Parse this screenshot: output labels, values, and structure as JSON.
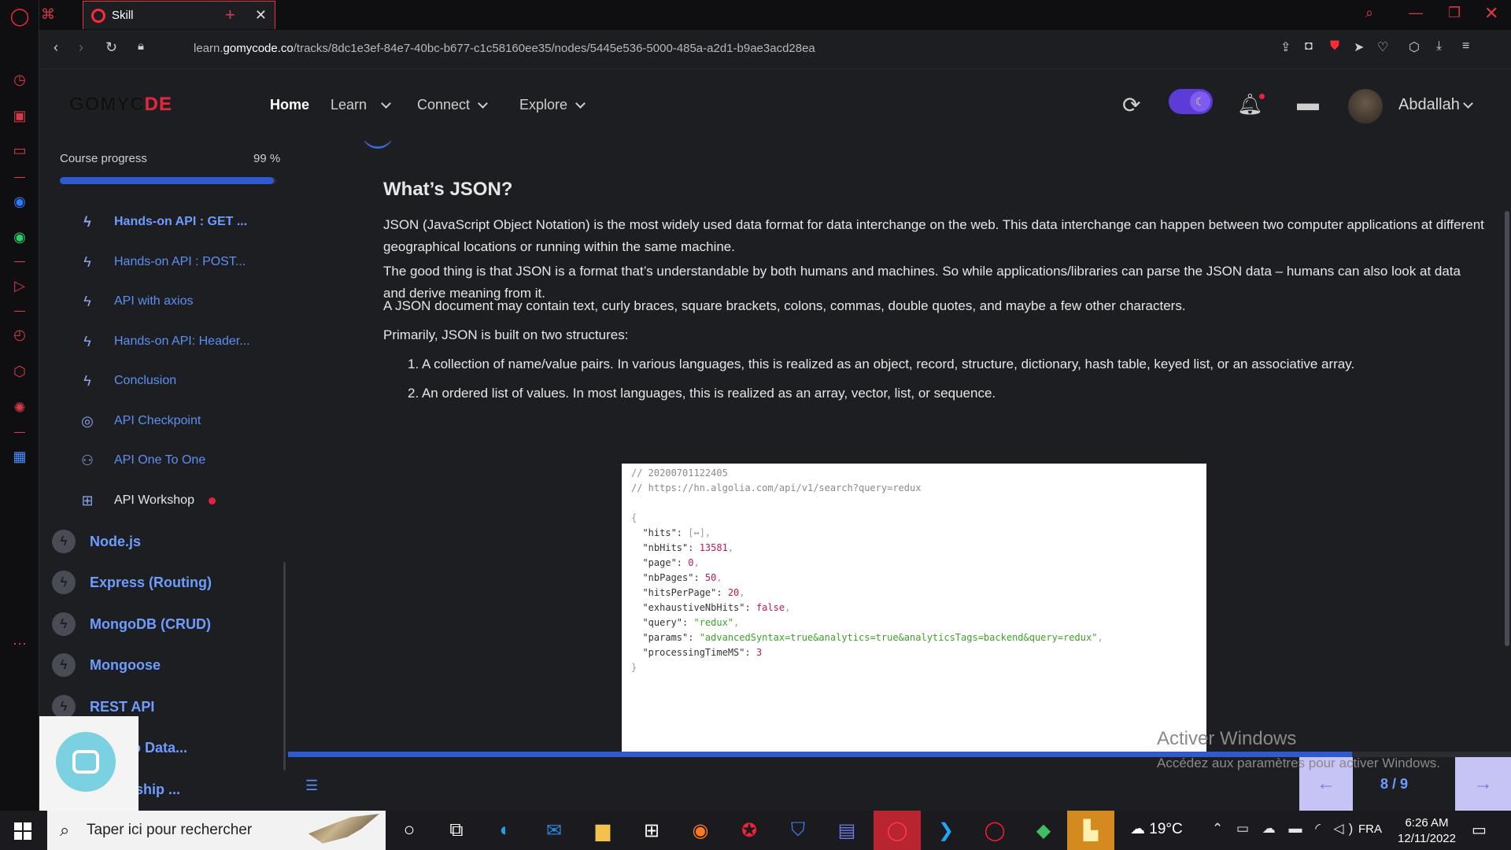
{
  "browser": {
    "tab_title": "Skill",
    "url_prefix": "learn.",
    "url_domain": "gomycode.co",
    "url_path": "/tracks/8dc1e3ef-84e7-40bc-b677-c1c58160ee35/nodes/5445e536-5000-485a-a2d1-b9ae3acd28ea"
  },
  "header": {
    "logo_part1": "GOMYC",
    "logo_part2": "DE",
    "nav": {
      "home": "Home",
      "learn": "Learn",
      "connect": "Connect",
      "explore": "Explore"
    },
    "username": "Abdallah"
  },
  "sidebar": {
    "progress_label": "Course progress",
    "progress_text": "99 %",
    "progress_value": 0.99,
    "lessons": [
      {
        "label": "Hands-on API : GET ...",
        "icon": "bolt-icon"
      },
      {
        "label": "Hands-on API : POST...",
        "icon": "bolt-icon"
      },
      {
        "label": "API with axios",
        "icon": "bolt-icon"
      },
      {
        "label": "Hands-on API: Header...",
        "icon": "bolt-icon"
      },
      {
        "label": "Conclusion",
        "icon": "bolt-icon"
      },
      {
        "label": "API Checkpoint",
        "icon": "target-icon"
      },
      {
        "label": "API One To One",
        "icon": "people-icon"
      },
      {
        "label": "API Workshop",
        "icon": "workshop-icon"
      }
    ],
    "modules": [
      {
        "label": "Node.js"
      },
      {
        "label": "Express (Routing)"
      },
      {
        "label": "MongoDB (CRUD)"
      },
      {
        "label": "Mongoose"
      },
      {
        "label": "REST API"
      },
      {
        "label": "ction to Data..."
      },
      {
        "label": "elationship ..."
      }
    ]
  },
  "content": {
    "title": "What’s JSON?",
    "p1": "JSON (JavaScript Object Notation) is the most widely used data format for data interchange on the web. This data interchange can happen between two computer applications at different geographical locations or running within the same machine.",
    "p2a": "The good thing is that JSON is a format that’s understandable by both humans and machines. So while applications/libraries can parse the JSON data – humans can also look at data and derive meaning from it.",
    "p2b": "A JSON document may contain text, curly braces, square brackets, colons, commas, double quotes, and maybe a few other characters.",
    "p3": "Primarily, JSON is built on two structures:",
    "li1": "1. A collection of name/value pairs. In various languages, this is realized as an object, record, structure, dictionary, hash table, keyed list, or an associative array.",
    "li2": "2. An ordered list of values. In most languages, this is realized as an array, vector, list, or sequence.",
    "code": {
      "c1": "// 20200701122405",
      "c2": "// https://hn.algolia.com/api/v1/search?query=redux",
      "open": "{",
      "hits_k": "  \"hits\": ",
      "hits_v": "[↔],",
      "nbHits_k": "  \"nbHits\": ",
      "nbHits_v": "13581",
      "page_k": "  \"page\": ",
      "page_v": "0",
      "nbPages_k": "  \"nbPages\": ",
      "nbPages_v": "50",
      "hpp_k": "  \"hitsPerPage\": ",
      "hpp_v": "20",
      "exh_k": "  \"exhaustiveNbHits\": ",
      "exh_v": "false",
      "query_k": "  \"query\": ",
      "query_v": "\"redux\"",
      "params_k": "  \"params\": ",
      "params_v": "\"advancedSyntax=true&analytics=true&analyticsTags=backend&query=redux\"",
      "pt_k": "  \"processingTimeMS\": ",
      "pt_v": "3",
      "close": "}"
    }
  },
  "footer": {
    "page_indicator": "8 / 9",
    "lesson_progress": 0.87
  },
  "watermark": {
    "title": "Activer Windows",
    "subtitle": "Accédez aux paramètres pour activer Windows."
  },
  "taskbar": {
    "search_placeholder": "Taper ici pour rechercher",
    "weather": "19°C",
    "language": "FRA",
    "time": "6:26 AM",
    "date": "12/11/2022"
  }
}
